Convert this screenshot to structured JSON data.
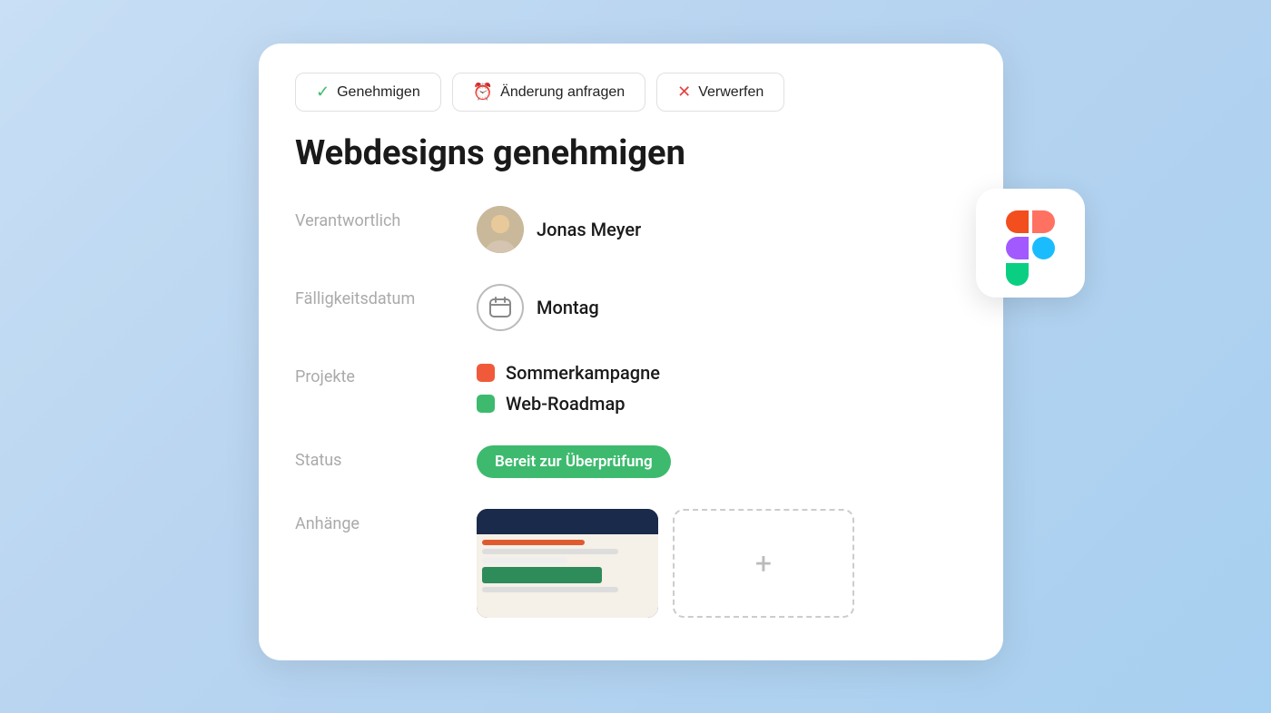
{
  "background": "#b8d4f0",
  "header": {
    "title": "Webdesigns genehmigen"
  },
  "actions": {
    "approve": "Genehmigen",
    "change": "Änderung anfragen",
    "reject": "Verwerfen"
  },
  "fields": {
    "responsible_label": "Verantwortlich",
    "responsible_name": "Jonas Meyer",
    "due_date_label": "Fälligkeitsdatum",
    "due_date_value": "Montag",
    "projects_label": "Projekte",
    "project1": "Sommerkampagne",
    "project2": "Web-Roadmap",
    "status_label": "Status",
    "status_value": "Bereit zur Überprüfung",
    "attachments_label": "Anhänge",
    "add_attachment_icon": "+"
  },
  "figma": {
    "alt": "Figma Logo"
  }
}
